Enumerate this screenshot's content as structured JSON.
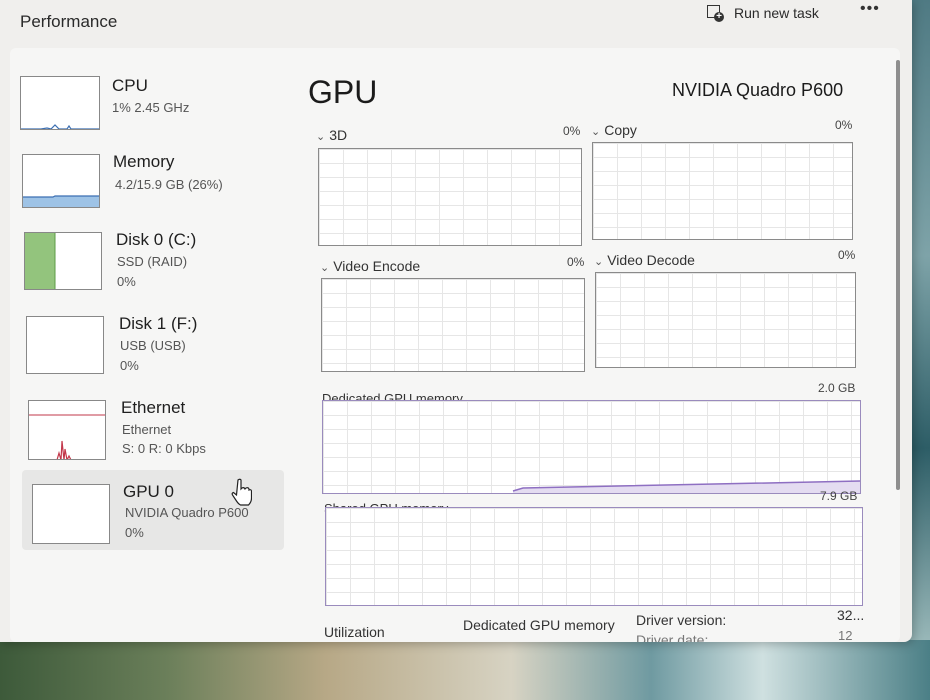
{
  "window": {
    "title": "Performance",
    "run_new_task": "Run new task",
    "more_label": "•••"
  },
  "sidebar": {
    "items": [
      {
        "name": "CPU",
        "sub1": "1% 2.45 GHz",
        "sub2": ""
      },
      {
        "name": "Memory",
        "sub1": "4.2/15.9 GB (26%)",
        "sub2": ""
      },
      {
        "name": "Disk 0 (C:)",
        "sub1": "SSD (RAID)",
        "sub2": "0%"
      },
      {
        "name": "Disk 1 (F:)",
        "sub1": "USB (USB)",
        "sub2": "0%"
      },
      {
        "name": "Ethernet",
        "sub1": "Ethernet",
        "sub2": "S: 0 R: 0 Kbps"
      },
      {
        "name": "GPU 0",
        "sub1": "NVIDIA Quadro P600",
        "sub2": "0%"
      }
    ]
  },
  "main": {
    "title": "GPU",
    "model": "NVIDIA Quadro P600",
    "engines": [
      {
        "label": "3D",
        "pct": "0%"
      },
      {
        "label": "Copy",
        "pct": "0%"
      },
      {
        "label": "Video Encode",
        "pct": "0%"
      },
      {
        "label": "Video Decode",
        "pct": "0%"
      }
    ],
    "dedicated": {
      "label": "Dedicated GPU memory",
      "max": "2.0 GB"
    },
    "shared": {
      "label": "Shared GPU memory",
      "max": "7.9 GB"
    },
    "stats": {
      "utilization_label": "Utilization",
      "dedicated_label": "Dedicated GPU memory",
      "driver_version_label": "Driver version:",
      "driver_version_value": "32...",
      "driver_date_label": "Driver date:",
      "driver_date_value": "12"
    }
  },
  "colors": {
    "cpu_line": "#3c6fb2",
    "memory_fill": "#9ec3e6",
    "disk_fill": "#93c47d",
    "ethernet_line": "#c2374a",
    "gpu_mem_line": "#8e6fc2"
  }
}
